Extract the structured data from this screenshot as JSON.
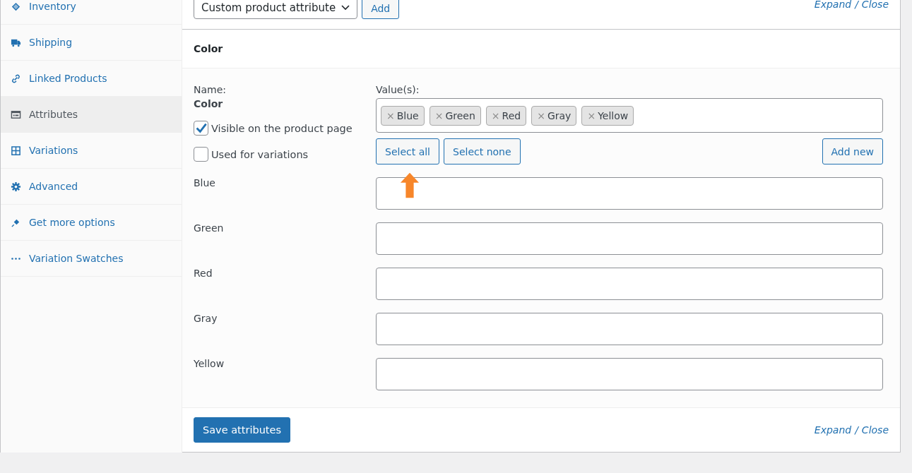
{
  "sidebar": {
    "items": [
      {
        "label": "Inventory",
        "kind": "inventory",
        "selected": false
      },
      {
        "label": "Shipping",
        "kind": "shipping",
        "selected": false
      },
      {
        "label": "Linked Products",
        "kind": "linked",
        "selected": false
      },
      {
        "label": "Attributes",
        "kind": "attributes",
        "selected": true
      },
      {
        "label": "Variations",
        "kind": "variations",
        "selected": false
      },
      {
        "label": "Advanced",
        "kind": "advanced",
        "selected": false
      },
      {
        "label": "Get more options",
        "kind": "plugin",
        "selected": false
      },
      {
        "label": "Variation Swatches",
        "kind": "swatches",
        "selected": false
      }
    ]
  },
  "toolbar": {
    "attribute_select": "Custom product attribute",
    "add_button": "Add",
    "links": [
      "Expand",
      "Close"
    ],
    "separator": "/"
  },
  "attribute": {
    "title": "Color",
    "name_label": "Name:",
    "name": "Color",
    "values_label": "Value(s):",
    "values": [
      "Blue",
      "Green",
      "Red",
      "Gray",
      "Yellow"
    ],
    "remove_mark": "×",
    "buttons": [
      "Select all",
      "Select none"
    ],
    "add_new": "Add new",
    "options": [
      {
        "label": "Visible on the product page",
        "checked": true
      },
      {
        "label": "Used for variations",
        "checked": false
      }
    ],
    "terms": [
      {
        "label": "Blue"
      },
      {
        "label": "Green"
      },
      {
        "label": "Red"
      },
      {
        "label": "Gray"
      },
      {
        "label": "Yellow"
      }
    ]
  },
  "footer": {
    "save_button": "Save attributes",
    "links": [
      "Expand",
      "Close"
    ],
    "separator": "/"
  }
}
